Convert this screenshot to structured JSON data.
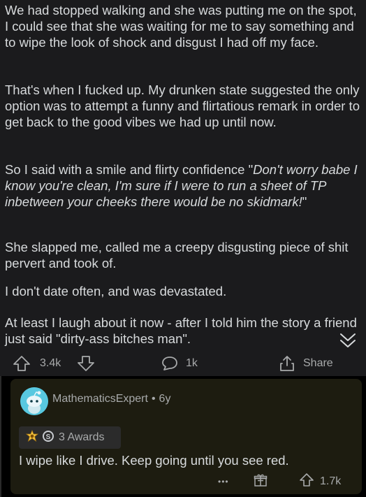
{
  "post": {
    "paragraphs": [
      "We had stopped walking and she was putting me on the spot, I could see that she was waiting for me to say something and to wipe the look of shock and disgust I had off my face.",
      "That's when I fucked up. My drunken state suggested the only option was to attempt a funny and flirtatious remark in order to get back to the good vibes we had up until now.",
      "So I said with a smile and flirty confidence \"",
      "Don't worry babe I know you're clean, I'm sure if I were to run a sheet of TP inbetween your cheeks there would be no skidmark!",
      "\"",
      "She slapped me, called me a creepy disgusting piece of shit pervert and took of.",
      "I don't date often, and was devastated.",
      "At least I laugh about it now - after I told him the story a friend just said \"dirty-ass bitches man\"."
    ],
    "upvotes": "3.4k",
    "comments": "1k",
    "share_label": "Share"
  },
  "comment": {
    "username": "MathematicsExpert",
    "separator": "•",
    "age": "6y",
    "awards_label": "3 Awards",
    "text": "I wipe like I drive.  Keep going until you see red.",
    "more": "•••",
    "upvotes": "1.7k"
  },
  "colors": {
    "post_bg": "#1b1b1d",
    "comment_bg": "#1d1c10",
    "text": "#d7dadc",
    "muted": "#a8aaab",
    "avatar": "#58c8e0"
  },
  "icons": [
    "upvote-icon",
    "downvote-icon",
    "comment-icon",
    "share-icon",
    "collapse-chevron-icon",
    "award-icon",
    "silver-award-icon",
    "more-icon",
    "gift-icon"
  ]
}
